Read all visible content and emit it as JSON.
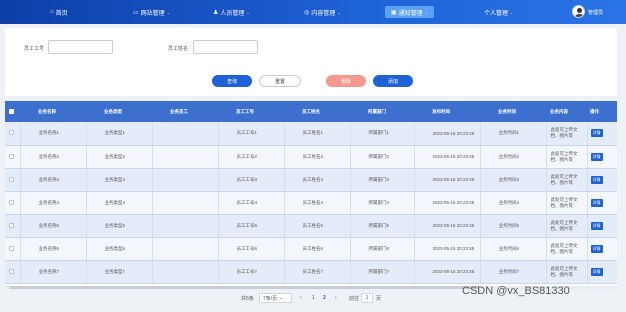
{
  "nav": {
    "items": [
      {
        "icon": "home-icon",
        "glyph": "⌂",
        "label": "首页",
        "caret": false
      },
      {
        "icon": "monitor-icon",
        "glyph": "▭",
        "label": "网站管理",
        "caret": true
      },
      {
        "icon": "person-icon",
        "glyph": "♟",
        "label": "人员管理",
        "caret": true
      },
      {
        "icon": "chat-icon",
        "glyph": "◎",
        "label": "内容管理",
        "caret": true
      },
      {
        "icon": "clipboard-icon",
        "glyph": "▣",
        "label": "通知管理",
        "caret": true
      },
      {
        "icon": "",
        "glyph": "",
        "label": "个人管理",
        "caret": true
      }
    ],
    "caret_glyph": "⌄",
    "username": "管理员"
  },
  "search": {
    "employee_no_label": "员工工号",
    "employee_no_value": "",
    "employee_name_label": "员工姓名",
    "employee_name_value": ""
  },
  "buttons": {
    "query": "查询",
    "reset": "重置",
    "delete": "删除",
    "add": "添加"
  },
  "table": {
    "headers": [
      "业务名称",
      "业务类型",
      "业务员工",
      "员工工号",
      "员工姓名",
      "所属部门",
      "发布时间",
      "业务时间",
      "业务内容",
      "操作"
    ],
    "detail_label": "详情",
    "rows": [
      [
        "业务名称1",
        "业务类型1",
        "",
        "员工工号1",
        "员工姓名1",
        "所属部门1",
        "2023-05-15 20:23:45",
        "业务时间1",
        "此处可上传文档、图片等",
        "详情"
      ],
      [
        "业务名称2",
        "业务类型2",
        "",
        "员工工号2",
        "员工姓名2",
        "所属部门2",
        "2023-05-15 20:23:45",
        "业务时间2",
        "此处可上传文档、图片等",
        "详情"
      ],
      [
        "业务名称3",
        "业务类型3",
        "",
        "员工工号3",
        "员工姓名3",
        "所属部门3",
        "2023-05-15 20:23:45",
        "业务时间3",
        "此处可上传文档、图片等",
        "详情"
      ],
      [
        "业务名称4",
        "业务类型4",
        "",
        "员工工号4",
        "员工姓名4",
        "所属部门4",
        "2023-05-15 20:23:45",
        "业务时间4",
        "此处可上传文档、图片等",
        "详情"
      ],
      [
        "业务名称5",
        "业务类型5",
        "",
        "员工工号5",
        "员工姓名5",
        "所属部门5",
        "2023-05-15 20:23:45",
        "业务时间5",
        "此处可上传文档、图片等",
        "详情"
      ],
      [
        "业务名称6",
        "业务类型6",
        "",
        "员工工号6",
        "员工姓名6",
        "所属部门6",
        "2023-05-15 20:23:45",
        "业务时间6",
        "此处可上传文档、图片等",
        "详情"
      ],
      [
        "业务名称7",
        "业务类型7",
        "",
        "员工工号7",
        "员工姓名7",
        "所属部门7",
        "2023-05-15 20:23:45",
        "业务时间7",
        "此处可上传文档、图片等",
        "详情"
      ]
    ]
  },
  "pagination": {
    "total": "共5条",
    "page_size": "7条/页",
    "prev": "‹",
    "pages": [
      "1",
      "2"
    ],
    "next": "›",
    "goto_label": "前往",
    "goto_value": "1",
    "page_suffix": "页"
  },
  "watermark": "CSDN @vx_BS81330",
  "colors": {
    "nav_bg": "#1a56c6",
    "primary": "#1e63d6",
    "danger": "#f59890",
    "table_header": "#3d6fcf"
  }
}
